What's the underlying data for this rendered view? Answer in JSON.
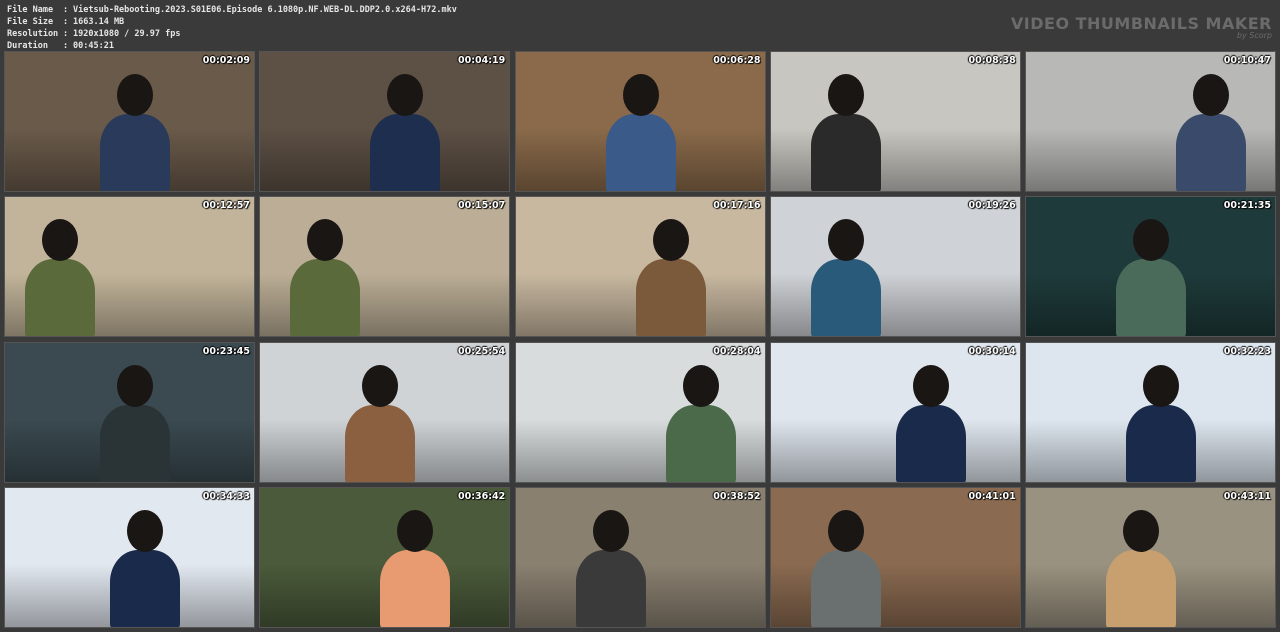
{
  "header": {
    "file_name_label": "File Name",
    "file_name": "Vietsub-Rebooting.2023.S01E06.Episode 6.1080p.NF.WEB-DL.DDP2.0.x264-H72.mkv",
    "file_size_label": "File Size",
    "file_size": "1663.14 MB",
    "resolution_label": "Resolution",
    "resolution": "1920x1080 / 29.97 fps",
    "duration_label": "Duration",
    "duration": "00:45:21",
    "separator": ":",
    "brand_title": "VIDEO THUMBNAILS MAKER",
    "brand_sub": "by Scorp"
  },
  "thumbnails": [
    {
      "time": "00:02:09",
      "bg": "#6a5a4a",
      "accent": "#2a3a5a"
    },
    {
      "time": "00:04:19",
      "bg": "#5d5045",
      "accent": "#1e2e4e"
    },
    {
      "time": "00:06:28",
      "bg": "#8a6a4a",
      "accent": "#3a5a8a"
    },
    {
      "time": "00:08:38",
      "bg": "#c8c6c0",
      "accent": "#2a2a2a"
    },
    {
      "time": "00:10:47",
      "bg": "#b8b8b6",
      "accent": "#3a4a6a"
    },
    {
      "time": "00:12:57",
      "bg": "#c2b49a",
      "accent": "#5a6a3a"
    },
    {
      "time": "00:15:07",
      "bg": "#bcae96",
      "accent": "#5a6a3a"
    },
    {
      "time": "00:17:16",
      "bg": "#c8b8a0",
      "accent": "#7a5a3a"
    },
    {
      "time": "00:19:26",
      "bg": "#cfd2d6",
      "accent": "#2a5a7a"
    },
    {
      "time": "00:21:35",
      "bg": "#1e3a3a",
      "accent": "#4a6a5a"
    },
    {
      "time": "00:23:45",
      "bg": "#3a4a50",
      "accent": "#2a3436"
    },
    {
      "time": "00:25:54",
      "bg": "#cfd3d6",
      "accent": "#8a6040"
    },
    {
      "time": "00:28:04",
      "bg": "#d8dcdc",
      "accent": "#4a6a4a"
    },
    {
      "time": "00:30:14",
      "bg": "#dfe6ee",
      "accent": "#1a2a4a"
    },
    {
      "time": "00:32:23",
      "bg": "#dde6ef",
      "accent": "#1a2a4a"
    },
    {
      "time": "00:34:33",
      "bg": "#e2e8f0",
      "accent": "#1a2a4a"
    },
    {
      "time": "00:36:42",
      "bg": "#4a5a3a",
      "accent": "#e89a70"
    },
    {
      "time": "00:38:52",
      "bg": "#8a8070",
      "accent": "#3a3a3a"
    },
    {
      "time": "00:41:01",
      "bg": "#8a6a50",
      "accent": "#6a7070"
    },
    {
      "time": "00:43:11",
      "bg": "#9a9280",
      "accent": "#c8a070"
    }
  ]
}
